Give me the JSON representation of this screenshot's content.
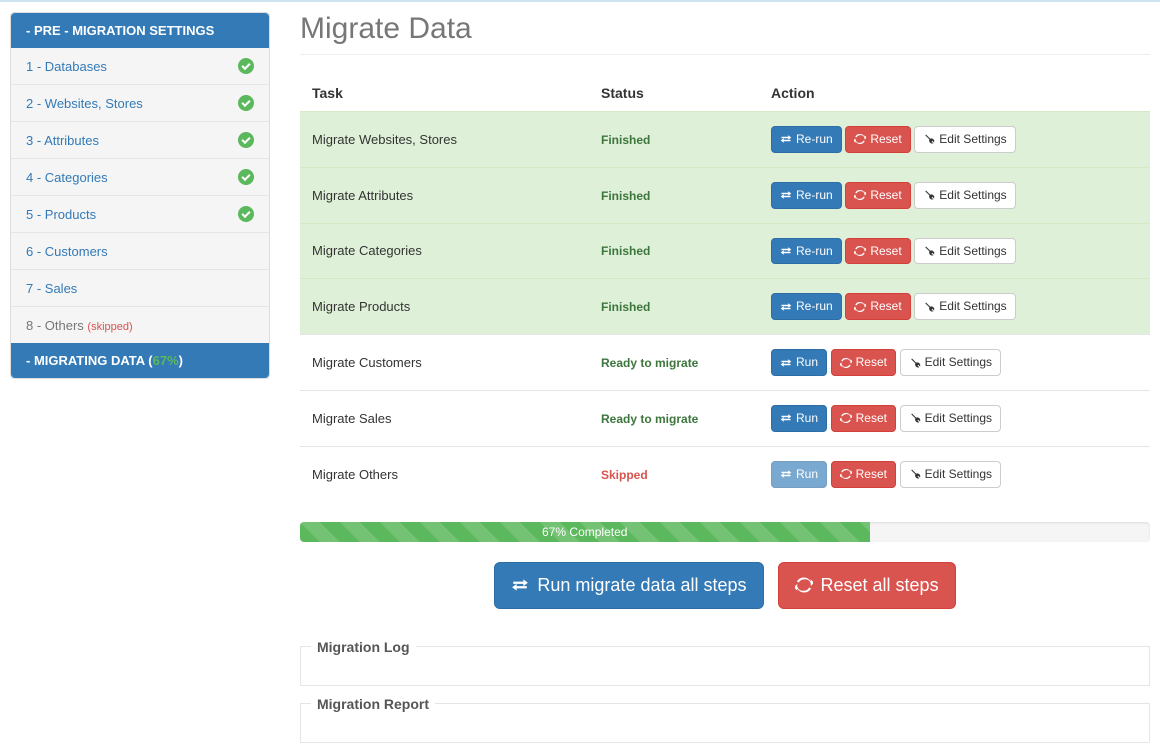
{
  "sidebar": {
    "preTitle": "- PRE - MIGRATION SETTINGS",
    "items": [
      {
        "label": "1 - Databases",
        "done": true
      },
      {
        "label": "2 - Websites, Stores",
        "done": true
      },
      {
        "label": "3 - Attributes",
        "done": true
      },
      {
        "label": "4 - Categories",
        "done": true
      },
      {
        "label": "5 - Products",
        "done": true
      },
      {
        "label": "6 - Customers",
        "done": false
      },
      {
        "label": "7 - Sales",
        "done": false
      },
      {
        "label": "8 - Others",
        "done": false,
        "skipped": true,
        "skippedLabel": "(skipped)"
      }
    ],
    "migTitlePrefix": "- MIGRATING DATA (",
    "migPct": "67%",
    "migTitleSuffix": ")"
  },
  "page": {
    "title": "Migrate Data"
  },
  "table": {
    "headers": {
      "task": "Task",
      "status": "Status",
      "action": "Action"
    },
    "rows": [
      {
        "task": "Migrate Websites, Stores",
        "status": "Finished",
        "statusClass": "status-finished",
        "rowClass": "row-finished",
        "runLabel": "Re-run",
        "runDisabled": false
      },
      {
        "task": "Migrate Attributes",
        "status": "Finished",
        "statusClass": "status-finished",
        "rowClass": "row-finished",
        "runLabel": "Re-run",
        "runDisabled": false
      },
      {
        "task": "Migrate Categories",
        "status": "Finished",
        "statusClass": "status-finished",
        "rowClass": "row-finished",
        "runLabel": "Re-run",
        "runDisabled": false
      },
      {
        "task": "Migrate Products",
        "status": "Finished",
        "statusClass": "status-finished",
        "rowClass": "row-finished",
        "runLabel": "Re-run",
        "runDisabled": false
      },
      {
        "task": "Migrate Customers",
        "status": "Ready to migrate",
        "statusClass": "status-ready",
        "rowClass": "",
        "runLabel": "Run",
        "runDisabled": false
      },
      {
        "task": "Migrate Sales",
        "status": "Ready to migrate",
        "statusClass": "status-ready",
        "rowClass": "",
        "runLabel": "Run",
        "runDisabled": false
      },
      {
        "task": "Migrate Others",
        "status": "Skipped",
        "statusClass": "status-skipped",
        "rowClass": "",
        "runLabel": "Run",
        "runDisabled": true
      }
    ],
    "resetLabel": "Reset",
    "editLabel": "Edit Settings"
  },
  "progress": {
    "pct": 67,
    "label": "67% Completed"
  },
  "actions": {
    "runAll": "Run migrate data all steps",
    "resetAll": "Reset all steps"
  },
  "panels": {
    "logTitle": "Migration Log",
    "reportTitle": "Migration Report"
  }
}
